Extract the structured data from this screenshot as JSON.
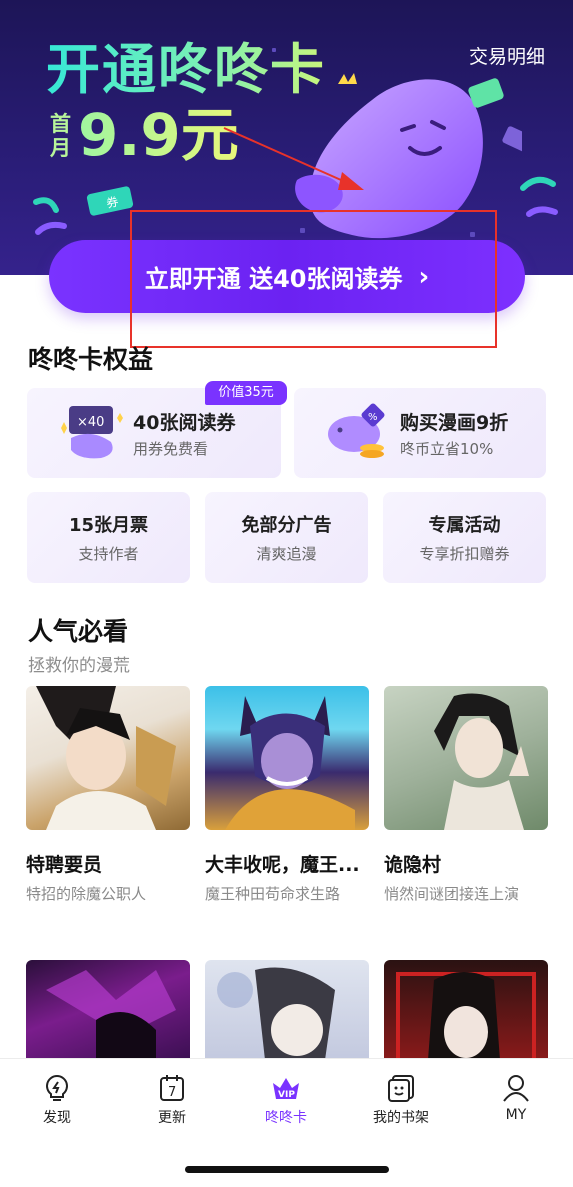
{
  "banner": {
    "promo_title": "开通咚咚卡",
    "price_prefix": "首月",
    "price": "9.9元",
    "transactions_link": "交易明细",
    "cta_label": "立即开通 送40张阅读券",
    "cta_icon": "chevron-right-icon",
    "ticket_multiplier": "×40",
    "ticket_deco_label": "券"
  },
  "benefits": {
    "title": "咚咚卡权益",
    "big": [
      {
        "title": "40张阅读券",
        "subtitle": "用券免费看",
        "badge": "价值35元",
        "icon": "ticket-icon"
      },
      {
        "title": "购买漫画9折",
        "subtitle": "咚币立省10%",
        "icon": "piggy-bank-icon"
      }
    ],
    "small": [
      {
        "title": "15张月票",
        "subtitle": "支持作者"
      },
      {
        "title": "免部分广告",
        "subtitle": "清爽追漫"
      },
      {
        "title": "专属活动",
        "subtitle": "专享折扣赠券"
      }
    ]
  },
  "popular": {
    "title": "人气必看",
    "subtitle": "拯救你的漫荒",
    "comics": [
      {
        "title": "特聘要员",
        "desc": "特招的除魔公职人"
      },
      {
        "title": "大丰收呢，魔王...",
        "desc": "魔王种田苟命求生路"
      },
      {
        "title": "诡隐村",
        "desc": "悄然间谜团接连上演"
      }
    ]
  },
  "tabbar": {
    "tabs": [
      {
        "label": "发现",
        "icon": "lightbulb-icon"
      },
      {
        "label": "更新",
        "icon": "calendar-icon",
        "icon_text": "7"
      },
      {
        "label": "咚咚卡",
        "icon": "vip-icon",
        "icon_text": "VIP"
      },
      {
        "label": "我的书架",
        "icon": "bookshelf-icon"
      },
      {
        "label": "MY",
        "icon": "user-icon"
      }
    ],
    "active": "咚咚卡"
  },
  "colors": {
    "accent": "#7a33ff",
    "banner_bg": "#231a66",
    "highlight_red": "#e8322a",
    "card_bg": "#f3effd"
  }
}
